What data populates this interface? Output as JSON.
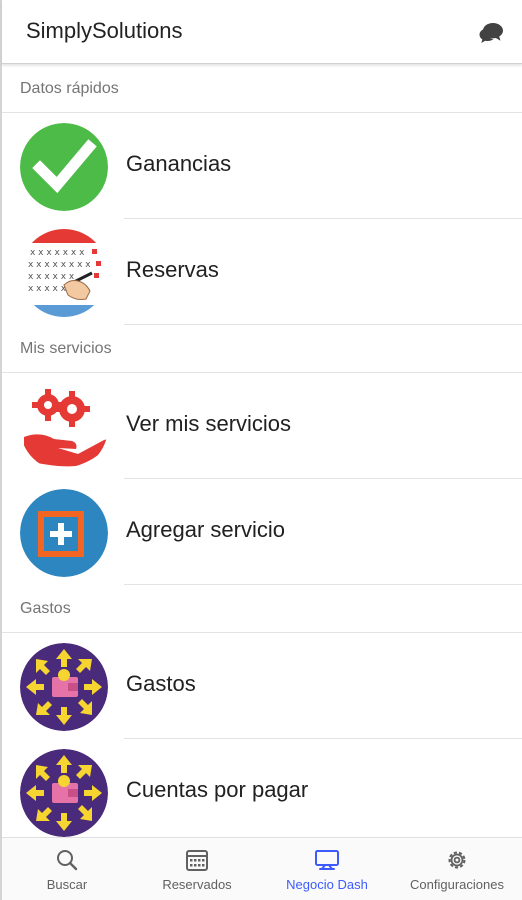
{
  "app": {
    "title": "SimplySolutions",
    "chat_icon": "chat-bubbles-icon"
  },
  "sections": [
    {
      "header": "Datos rápidos",
      "items": [
        {
          "label": "Ganancias",
          "icon": "check-circle-icon"
        },
        {
          "label": "Reservas",
          "icon": "calendar-reservations-icon"
        }
      ]
    },
    {
      "header": "Mis servicios",
      "items": [
        {
          "label": "Ver mis servicios",
          "icon": "hand-gears-icon"
        },
        {
          "label": "Agregar servicio",
          "icon": "add-square-icon"
        }
      ]
    },
    {
      "header": "Gastos",
      "items": [
        {
          "label": "Gastos",
          "icon": "wallet-arrows-icon"
        },
        {
          "label": "Cuentas por pagar",
          "icon": "wallet-arrows-icon"
        }
      ]
    }
  ],
  "bottom_nav": {
    "items": [
      {
        "label": "Buscar",
        "icon": "search-icon",
        "active": false
      },
      {
        "label": "Reservados",
        "icon": "calendar-icon",
        "active": false
      },
      {
        "label": "Negocio Dash",
        "icon": "monitor-icon",
        "active": true
      },
      {
        "label": "Configuraciones",
        "icon": "gear-icon",
        "active": false
      }
    ]
  },
  "colors": {
    "accent": "#3d5afe",
    "check_green": "#4cbb47",
    "calendar_red": "#e53935",
    "gear_red": "#e53935",
    "add_blue": "#2e86c1",
    "add_orange": "#f26522",
    "wallet_purple": "#4a2a7a",
    "arrow_yellow": "#f7d531",
    "wallet_pink": "#e573a7"
  }
}
